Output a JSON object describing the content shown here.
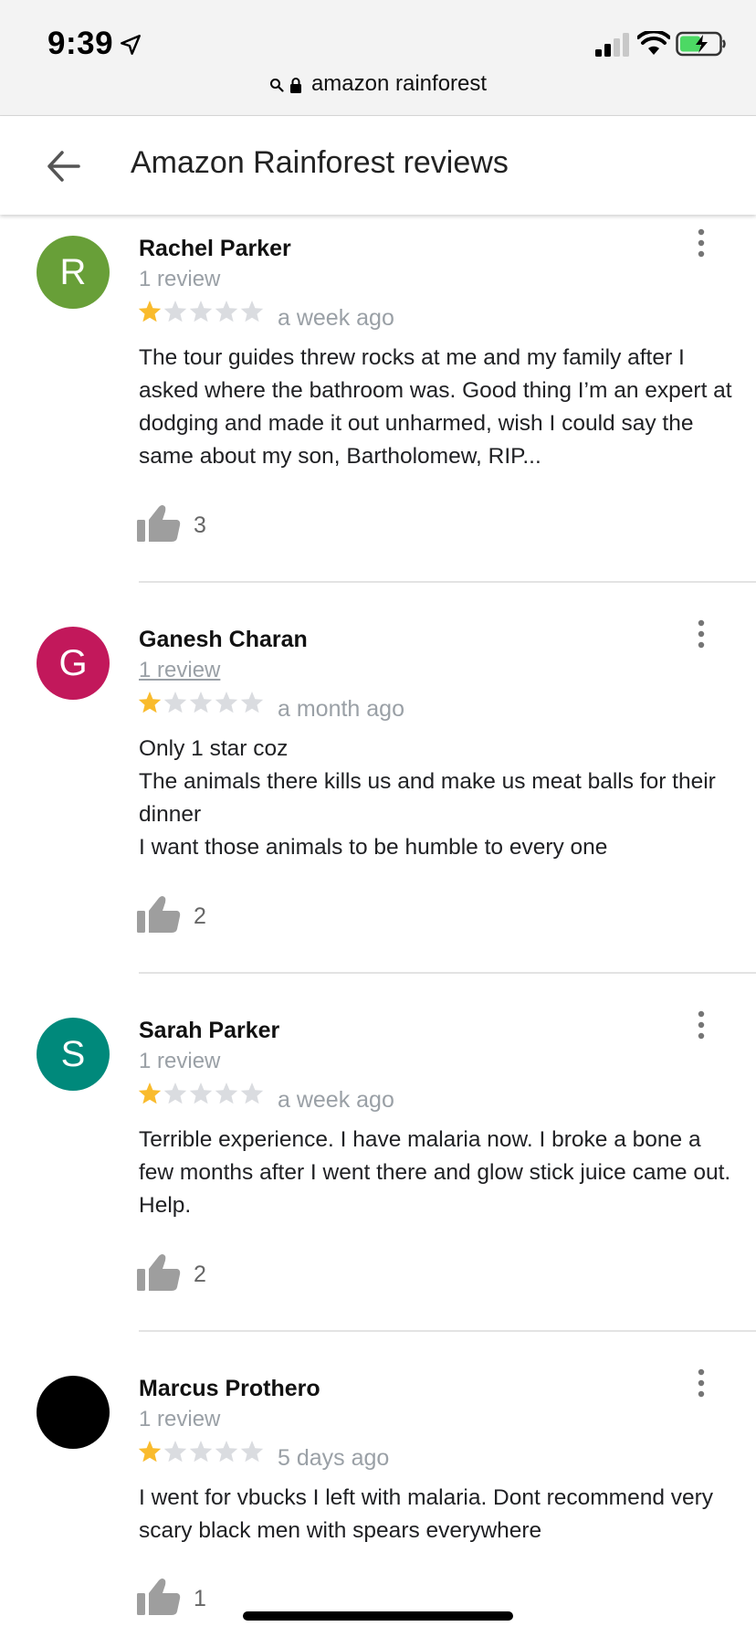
{
  "status_bar": {
    "time": "9:39",
    "url": "amazon rainforest"
  },
  "header": {
    "title": "Amazon Rainforest reviews"
  },
  "colors": {
    "star_filled": "#f9bb2d",
    "star_empty": "#dadce0"
  },
  "reviews": [
    {
      "initial": "R",
      "avatar_color": "#689f38",
      "name": "Rachel Parker",
      "review_count": "1 review",
      "rating": 1,
      "time": "a week ago",
      "text": "The tour guides threw rocks at me and my family after I asked where the bathroom was. Good thing I’m an expert at dodging and made it out unharmed, wish I could say the same about my son, Bartholomew, RIP...",
      "likes": "3"
    },
    {
      "initial": "G",
      "avatar_color": "#c2185b",
      "name": "Ganesh Charan",
      "review_count": "1 review",
      "rating": 1,
      "time": "a month ago",
      "text": "Only 1 star coz\nThe animals there kills us and make us meat balls for their dinner\nI want those animals to be humble to every one",
      "likes": "2"
    },
    {
      "initial": "S",
      "avatar_color": "#00897b",
      "name": "Sarah Parker",
      "review_count": "1 review",
      "rating": 1,
      "time": "a week ago",
      "text": "Terrible experience. I have malaria now. I broke a bone a few months after I went there and glow stick juice came out. Help.",
      "likes": "2"
    },
    {
      "initial": "",
      "avatar_color": "#000000",
      "name": "Marcus Prothero",
      "review_count": "1 review",
      "rating": 1,
      "time": "5 days ago",
      "text": "I went for vbucks I left with malaria. Dont recommend very scary black men with spears everywhere",
      "likes": "1"
    }
  ]
}
